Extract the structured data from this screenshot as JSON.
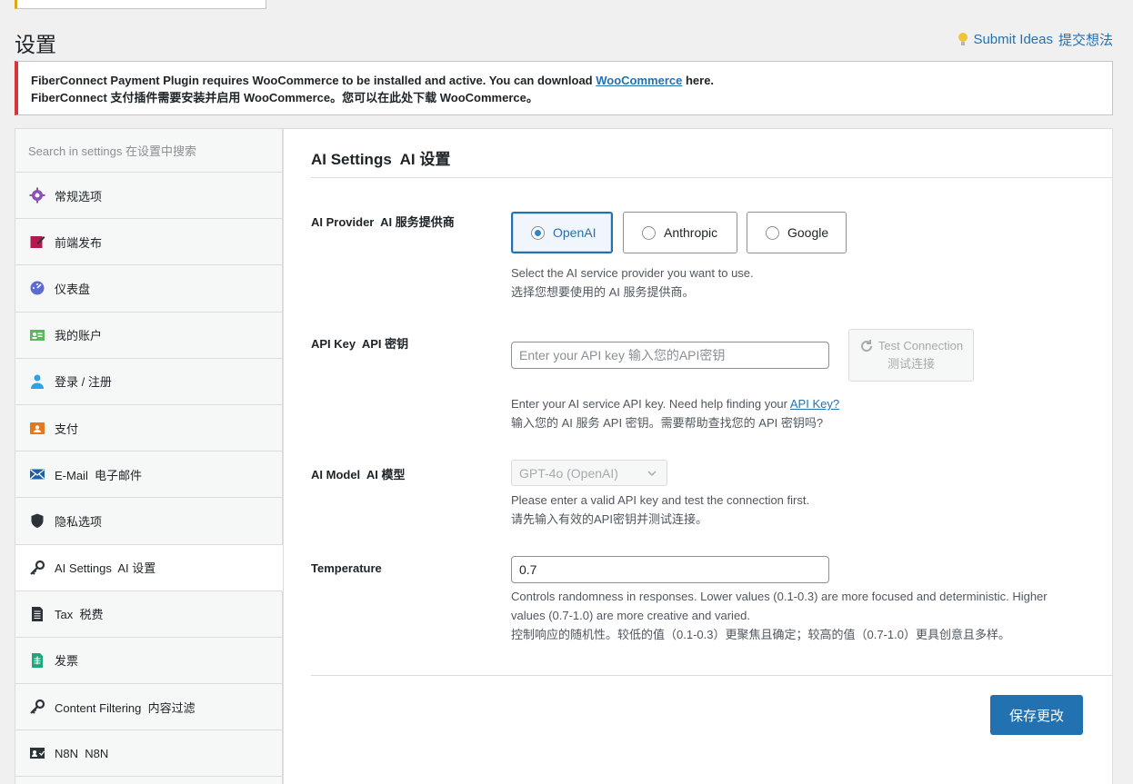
{
  "page": {
    "title": "设置",
    "submit_ideas_en": "Submit Ideas",
    "submit_ideas_zh": "提交想法"
  },
  "notice": {
    "line1_before": "FiberConnect Payment Plugin requires WooCommerce to be installed and active. You can download ",
    "line1_link": "WooCommerce",
    "line1_after": " here.",
    "line2": "FiberConnect 支付插件需要安装并启用 WooCommerce。您可以在此处下载 WooCommerce。"
  },
  "sidebar": {
    "search_placeholder": "Search in settings 在设置中搜索",
    "items": [
      {
        "label": "常规选项",
        "icon": "gear-icon",
        "color": "#8c4fb5"
      },
      {
        "label": "前端发布",
        "icon": "edit-icon",
        "color": "#b5184f"
      },
      {
        "label": "仪表盘",
        "icon": "dashboard-icon",
        "color": "#5b6bd1"
      },
      {
        "label": "我的账户",
        "icon": "id-card-icon",
        "color": "#5cb85c"
      },
      {
        "label": "登录 / 注册",
        "icon": "user-icon",
        "color": "#2ea2e6"
      },
      {
        "label": "支付",
        "icon": "payment-icon",
        "color": "#e8761d"
      },
      {
        "label": "E-Mail  电子邮件",
        "icon": "email-icon",
        "color": "#1d5fa5"
      },
      {
        "label": "隐私选项",
        "icon": "shield-icon",
        "color": "#2c3338"
      },
      {
        "label": "AI Settings  AI 设置",
        "icon": "key-icon",
        "color": "#2c3338"
      },
      {
        "label": "Tax  税费",
        "icon": "document-icon",
        "color": "#2c3338"
      },
      {
        "label": "发票",
        "icon": "invoice-icon",
        "color": "#1fa67a"
      },
      {
        "label": "Content Filtering  内容过滤",
        "icon": "key-icon",
        "color": "#2c3338"
      },
      {
        "label": "N8N  N8N",
        "icon": "n8n-icon",
        "color": "#2c3338"
      }
    ],
    "active_index": 8
  },
  "main": {
    "title": "AI Settings  AI 设置",
    "provider": {
      "label": "AI Provider  AI 服务提供商",
      "options": [
        "OpenAI",
        "Anthropic",
        "Google"
      ],
      "selected": "OpenAI",
      "desc_en": "Select the AI service provider you want to use.",
      "desc_zh": "选择您想要使用的 AI 服务提供商。"
    },
    "api_key": {
      "label": "API Key  API 密钥",
      "placeholder": "Enter your API key 输入您的API密钥",
      "value": "",
      "test_button_en": "Test Connection",
      "test_button_zh": "测试连接",
      "desc_en_before": "Enter your AI service API key. Need help finding your ",
      "desc_link": "API Key?",
      "desc_zh": "输入您的 AI 服务 API 密钥。需要帮助查找您的 API 密钥吗?"
    },
    "model": {
      "label": "AI Model  AI 模型",
      "selected": "GPT-4o (OpenAI)",
      "desc_en": "Please enter a valid API key and test the connection first.",
      "desc_zh": "请先输入有效的API密钥并测试连接。"
    },
    "temperature": {
      "label": "Temperature",
      "value": "0.7",
      "desc_en_1": "Controls randomness in responses. Lower values (0.1-0.3) are more focused and deterministic. Higher",
      "desc_en_2": "values (0.7-1.0) are more creative and varied.",
      "desc_zh": "控制响应的随机性。较低的值（0.1-0.3）更聚焦且确定；较高的值（0.7-1.0）更具创意且多样。"
    },
    "save_button": "保存更改"
  },
  "colors": {
    "accent": "#2271b1",
    "notice_error": "#d63638",
    "bulb": "#f0c33c"
  }
}
